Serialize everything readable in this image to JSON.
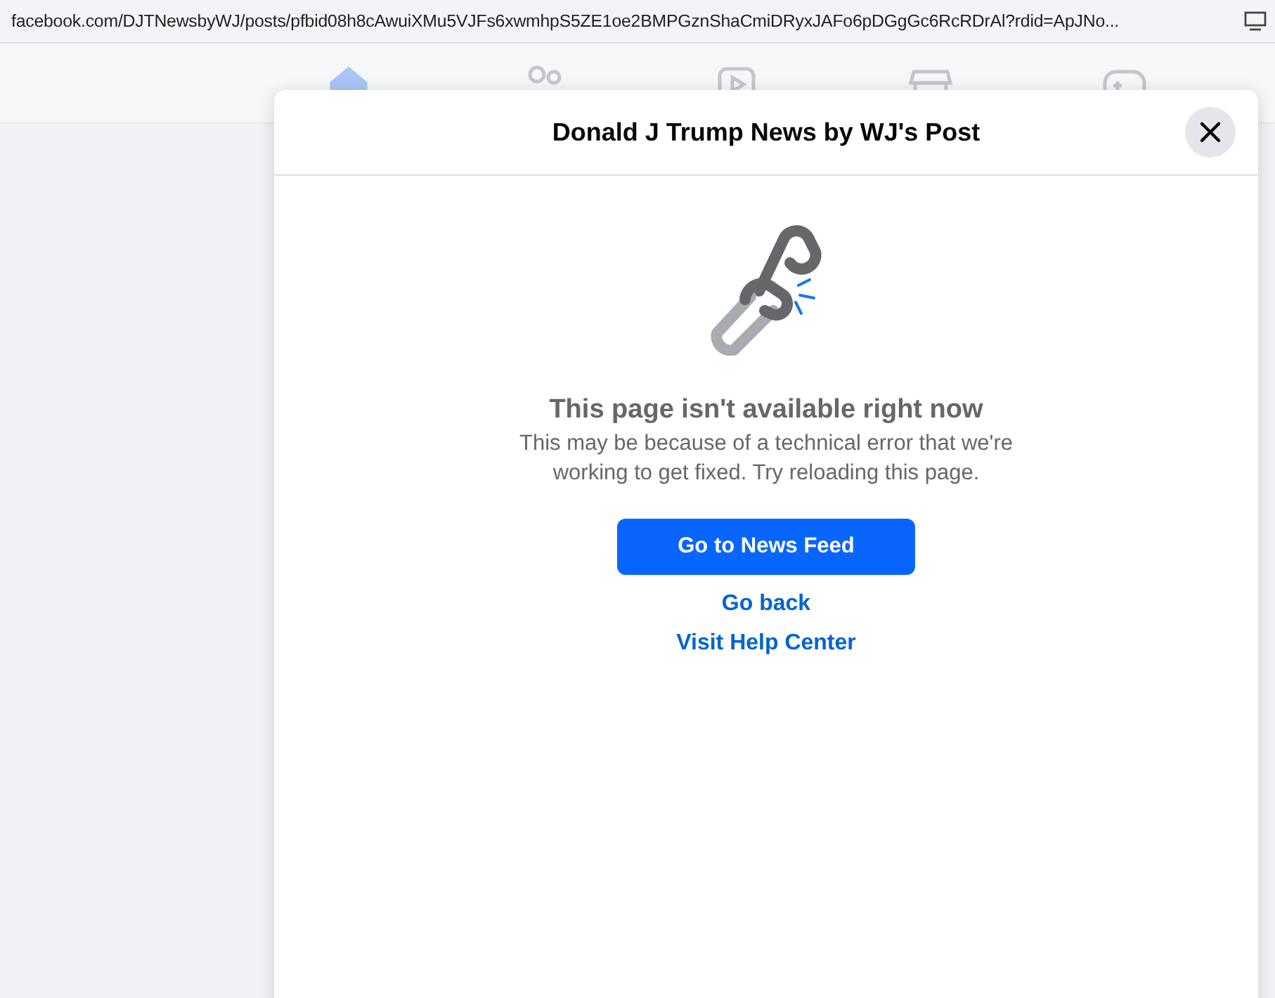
{
  "address_bar": {
    "url": "facebook.com/DJTNewsbyWJ/posts/pfbid08h8cAwuiXMu5VJFs6xwmhpS5ZE1oe2BMPGznShaCmiDRyxJAFo6pDGgGc6RcRDrAl?rdid=ApJNo..."
  },
  "nav": [
    {
      "kind": "home",
      "selected": true
    },
    {
      "kind": "friends",
      "selected": false
    },
    {
      "kind": "video",
      "selected": false
    },
    {
      "kind": "marketplace",
      "selected": false
    },
    {
      "kind": "gaming",
      "selected": false
    }
  ],
  "dialog": {
    "title": "Donald J Trump News by WJ's Post",
    "heading": "This page isn't available right now",
    "message": "This may be because of a technical error that we're working to get fixed. Try reloading this page.",
    "primary_button": "Go to News Feed",
    "links": [
      "Go back",
      "Visit Help Center"
    ]
  }
}
